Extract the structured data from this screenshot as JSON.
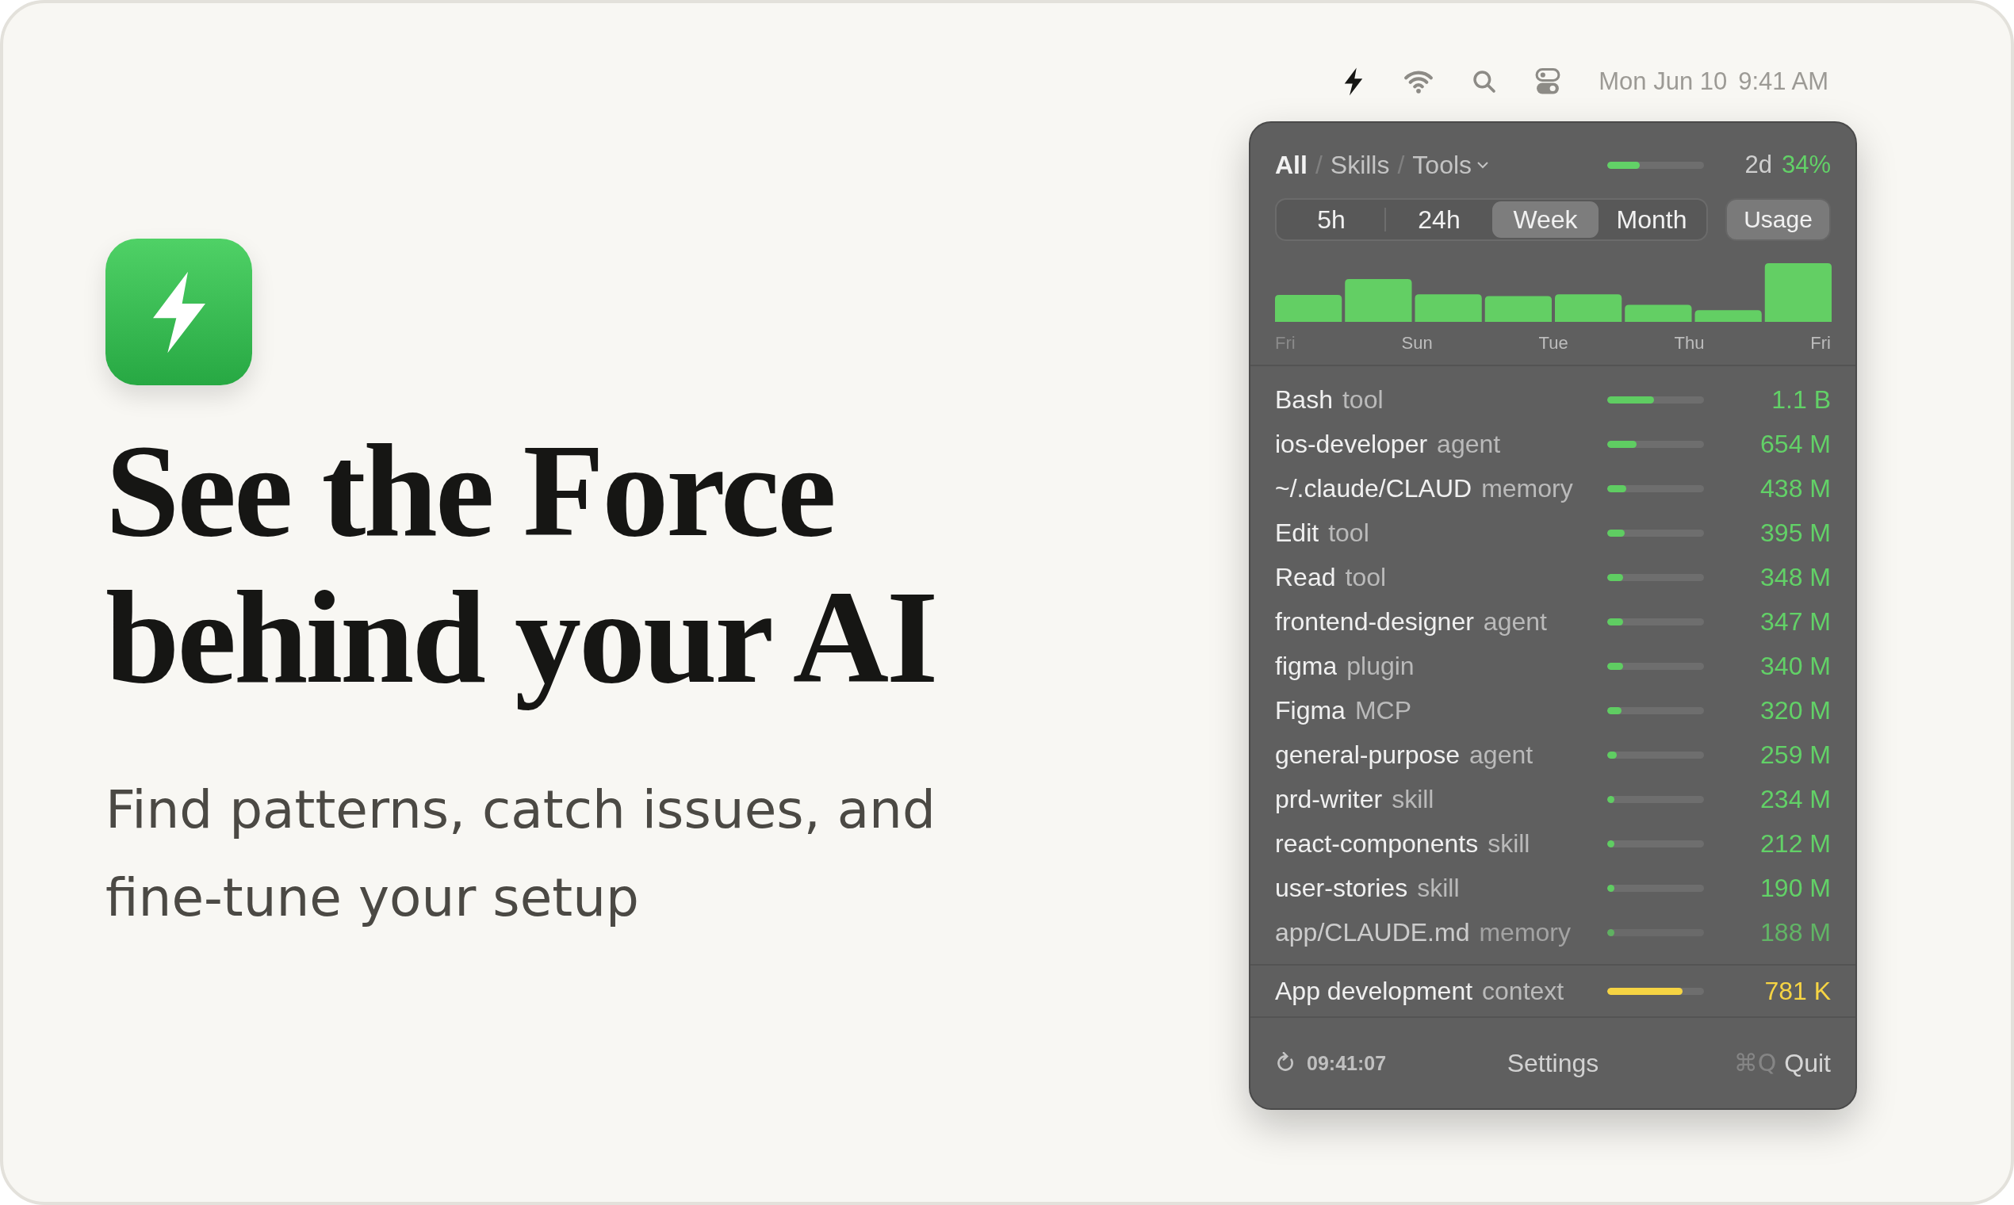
{
  "menu_bar": {
    "date": "Mon Jun 10",
    "time": "9:41 AM"
  },
  "hero": {
    "headline": "See the Force behind your AI",
    "subtitle": "Find patterns, catch issues, and fine-tune your setup"
  },
  "popover": {
    "breadcrumb": [
      {
        "label": "All",
        "selected": true
      },
      {
        "separator": "/",
        "label": "Skills",
        "selected": false
      },
      {
        "separator": "/",
        "label": "Tools",
        "selected": false
      }
    ],
    "quota": {
      "level": 0.34,
      "period": "2d",
      "percent": "34%"
    },
    "ranges": [
      {
        "label": "5h",
        "selected": false
      },
      {
        "label": "24h",
        "selected": false
      },
      {
        "label": "Week",
        "selected": true
      },
      {
        "label": "Month",
        "selected": false
      }
    ],
    "usage_button": {
      "label": "Usage",
      "on": true
    },
    "chart_labels": [
      "Fri",
      "Sun",
      "Tue",
      "Thu",
      "Fri"
    ],
    "rows": [
      {
        "name": "Bash",
        "type": "tool",
        "level": 0.48,
        "value": "1.1 B"
      },
      {
        "name": "ios-developer",
        "type": "agent",
        "level": 0.3,
        "value": "654 M"
      },
      {
        "name": "~/.claude/CLAUD",
        "type": "memory",
        "level": 0.2,
        "value": "438 M"
      },
      {
        "name": "Edit",
        "type": "tool",
        "level": 0.18,
        "value": "395 M"
      },
      {
        "name": "Read",
        "type": "tool",
        "level": 0.16,
        "value": "348 M"
      },
      {
        "name": "frontend-designer",
        "type": "agent",
        "level": 0.16,
        "value": "347 M"
      },
      {
        "name": "figma",
        "type": "plugin",
        "level": 0.16,
        "value": "340 M"
      },
      {
        "name": "Figma",
        "type": "MCP",
        "level": 0.15,
        "value": "320 M"
      },
      {
        "name": "general-purpose",
        "type": "agent",
        "level": 0.1,
        "value": "259 M"
      },
      {
        "name": "prd-writer",
        "type": "skill",
        "level": 0.07,
        "value": "234 M"
      },
      {
        "name": "react-components",
        "type": "skill",
        "level": 0.06,
        "value": "212 M"
      },
      {
        "name": "user-stories",
        "type": "skill",
        "level": 0.05,
        "value": "190 M"
      },
      {
        "name": "app/CLAUDE.md",
        "type": "memory",
        "level": 0.05,
        "value": "188 M"
      }
    ],
    "context": {
      "name": "App development",
      "type": "context",
      "level": 0.78,
      "value": "781 K"
    },
    "footer": {
      "refreshed": "09:41:07",
      "settings": "Settings",
      "shortcut": "⌘Q",
      "quit": "Quit"
    }
  }
}
